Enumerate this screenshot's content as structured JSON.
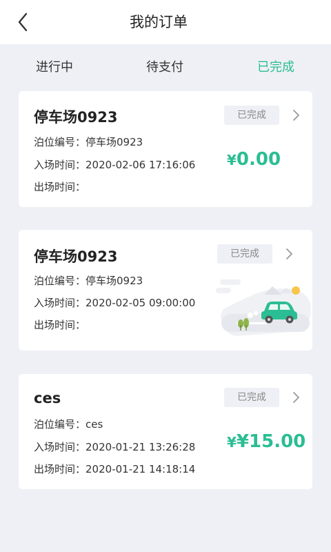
{
  "header": {
    "title": "我的订单",
    "back_icon": "chevron-left-icon"
  },
  "tabs": [
    {
      "label": "进行中",
      "active": false
    },
    {
      "label": "待支付",
      "active": false
    },
    {
      "label": "已完成",
      "active": true
    }
  ],
  "colors": {
    "accent": "#2bbd93",
    "background": "#eef0f5",
    "badge_bg": "#eef0f5",
    "badge_text": "#888888"
  },
  "orders": [
    {
      "title": "停车场0923",
      "status": "已完成",
      "berth_label": "泊位编号：",
      "berth": "停车场0923",
      "entry_label": "入场时间：",
      "entry_time": "2020-02-06 17:16:06",
      "exit_label": "出场时间：",
      "exit_time": "",
      "amount_prefix": "¥",
      "amount": "0.00"
    },
    {
      "title": "停车场0923",
      "status": "已完成",
      "berth_label": "泊位编号：",
      "berth": "停车场0923",
      "entry_label": "入场时间：",
      "entry_time": "2020-02-05 09:00:00",
      "exit_label": "出场时间：",
      "exit_time": "",
      "illustration": "parked-car-illustration"
    },
    {
      "title": "ces",
      "status": "已完成",
      "berth_label": "泊位编号：",
      "berth": "ces",
      "entry_label": "入场时间：",
      "entry_time": "2020-01-21 13:26:28",
      "exit_label": "出场时间：",
      "exit_time": "2020-01-21 14:18:14",
      "amount_prefix": "¥",
      "amount": "¥15.00"
    }
  ]
}
